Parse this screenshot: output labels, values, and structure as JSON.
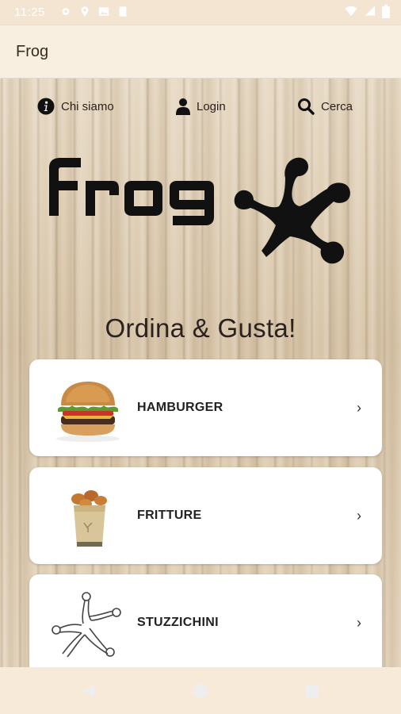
{
  "status_bar": {
    "time": "11:25",
    "icons": [
      "settings-icon",
      "location-icon",
      "image-icon",
      "sd-card-icon",
      "wifi-icon",
      "signal-icon",
      "battery-icon"
    ]
  },
  "app_bar": {
    "title": "Frog"
  },
  "nav": {
    "info_label": "Chi siamo",
    "login_label": "Login",
    "search_label": "Cerca"
  },
  "tagline": "Ordina & Gusta!",
  "categories": [
    {
      "label": "HAMBURGER",
      "icon": "burger-icon"
    },
    {
      "label": "FRITTURE",
      "icon": "fries-icon"
    },
    {
      "label": "STUZZICHINI",
      "icon": "frog-foot-icon"
    }
  ],
  "chevron": "›",
  "colors": {
    "app_bar": "#f9efe0",
    "text_dark": "#3b2a22",
    "card": "#ffffff",
    "logo": "#111111"
  }
}
